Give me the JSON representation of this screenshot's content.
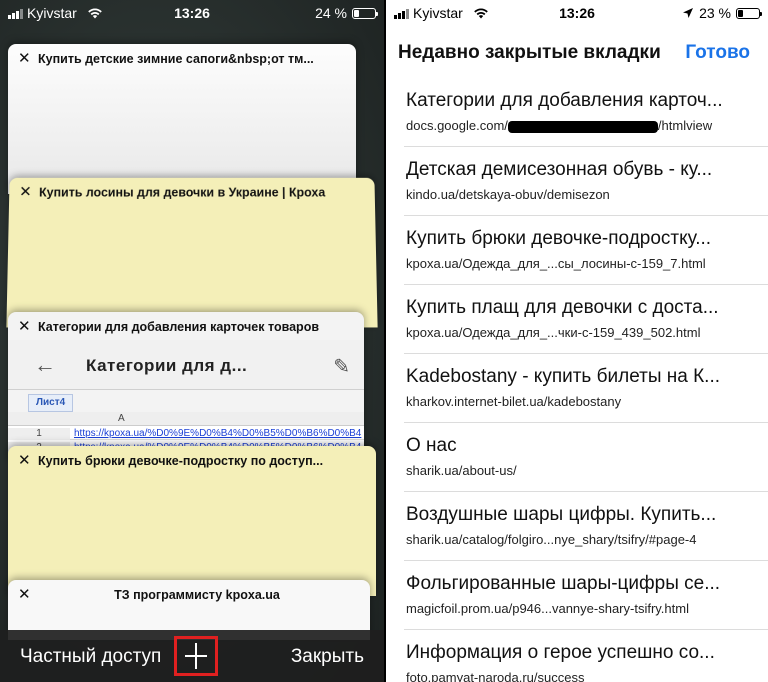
{
  "left_status": {
    "carrier": "Kyivstar",
    "time": "13:26",
    "battery": "24 %",
    "battery_level": 0.24
  },
  "right_status": {
    "carrier": "Kyivstar",
    "time": "13:26",
    "battery": "23 %",
    "battery_level": 0.23
  },
  "tabs": [
    {
      "title": "Купить детские зимние сапоги&nbsp;от тм..."
    },
    {
      "title": "Купить лосины для девочки в Украине | Кроха"
    },
    {
      "title": "Категории для добавления карточек товаров"
    },
    {
      "title": "Купить брюки девочке-подростку по доступ..."
    },
    {
      "title": "ТЗ программисту kpoxa.ua"
    }
  ],
  "doc_preview": {
    "title": "Категории для д...",
    "sheet_tab": "Лист4",
    "column": "A",
    "rows": [
      {
        "n": "1",
        "link": "https://kpoxa.ua/%D0%9E%D0%B4%D0%B5%D0%B6%D0%B4"
      },
      {
        "n": "2",
        "link": "https://kpoxa.ua/%D0%9E%D0%B4%D0%B5%D0%B6%D0%B4"
      }
    ]
  },
  "bottombar": {
    "private": "Частный доступ",
    "close": "Закрыть"
  },
  "recent": {
    "title": "Недавно закрытые вкладки",
    "done": "Готово",
    "items": [
      {
        "title": "Категории для добавления карточ...",
        "url_prefix": "docs.google.com/",
        "url_suffix": "/htmlview"
      },
      {
        "title": "Детская демисезонная обувь - ку...",
        "url": "kindo.ua/detskaya-obuv/demisezon"
      },
      {
        "title": "Купить брюки девочке-подростку...",
        "url": "kpoxa.ua/Одежда_для_...сы_лосины-с-159_7.html"
      },
      {
        "title": "Купить плащ для девочки с доста...",
        "url": "kpoxa.ua/Одежда_для_...чки-с-159_439_502.html"
      },
      {
        "title": "Kadebostany - купить билеты на К...",
        "url": "kharkov.internet-bilet.ua/kadebostany"
      },
      {
        "title": "О нас",
        "url": "sharik.ua/about-us/"
      },
      {
        "title": "Воздушные шары цифры. Купить...",
        "url": "sharik.ua/catalog/folgiro...nye_shary/tsifry/#page-4"
      },
      {
        "title": "Фольгированные шары-цифры се...",
        "url": "magicfoil.prom.ua/p946...vannye-shary-tsifry.html"
      },
      {
        "title": "Информация о герое успешно со...",
        "url": "foto.pamyat-naroda.ru/success"
      }
    ]
  }
}
